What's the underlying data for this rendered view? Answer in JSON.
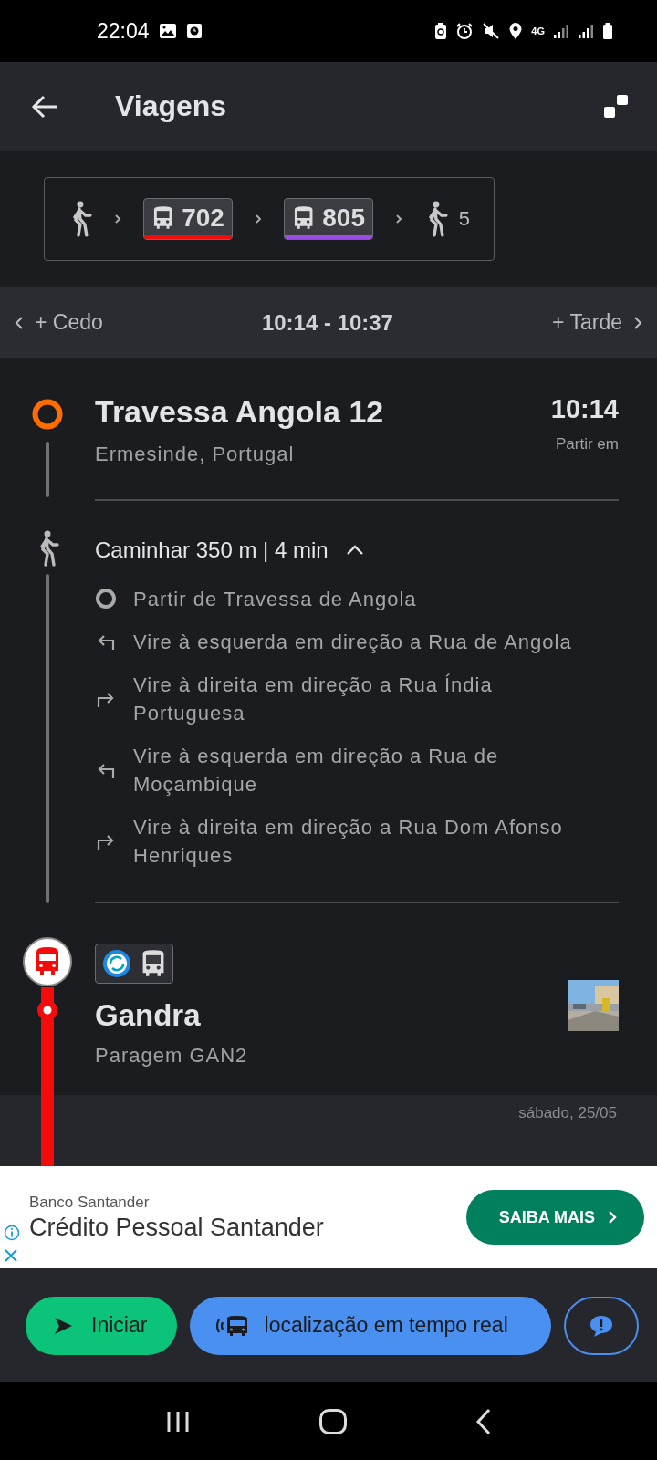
{
  "status_bar": {
    "time": "22:04",
    "network": "4G"
  },
  "app_bar": {
    "title": "Viagens"
  },
  "route_summary": [
    {
      "kind": "walk"
    },
    {
      "kind": "bus",
      "line": "702",
      "color": "#f20c0c"
    },
    {
      "kind": "bus",
      "line": "805",
      "color": "#9b4dea"
    },
    {
      "kind": "walk",
      "count": "5"
    }
  ],
  "time_selector": {
    "earlier": "+ Cedo",
    "range": "10:14 - 10:37",
    "later": "+ Tarde"
  },
  "origin": {
    "name": "Travessa Angola 12",
    "place": "Ermesinde, Portugal",
    "time": "10:14",
    "time_label": "Partir em"
  },
  "walk": {
    "summary": "Caminhar 350 m | 4 min",
    "expanded": true,
    "steps": [
      {
        "kind": "depart",
        "text": "Partir de Travessa de Angola"
      },
      {
        "kind": "left",
        "text": "Vire à esquerda em direção a Rua de Angola"
      },
      {
        "kind": "right",
        "text": "Vire à direita em direção a Rua Índia Portuguesa"
      },
      {
        "kind": "left",
        "text": "Vire à esquerda em direção a Rua de Moçambique"
      },
      {
        "kind": "right",
        "text": "Vire à direita em direção a Rua Dom Afonso Henriques"
      }
    ]
  },
  "stop": {
    "name": "Gandra",
    "code": "Paragem GAN2"
  },
  "date": "sábado, 25/05",
  "ad": {
    "advertiser": "Banco Santander",
    "headline": "Crédito Pessoal Santander",
    "cta": "SAIBA MAIS"
  },
  "actions": {
    "start": "Iniciar",
    "live": "localização em tempo real"
  }
}
